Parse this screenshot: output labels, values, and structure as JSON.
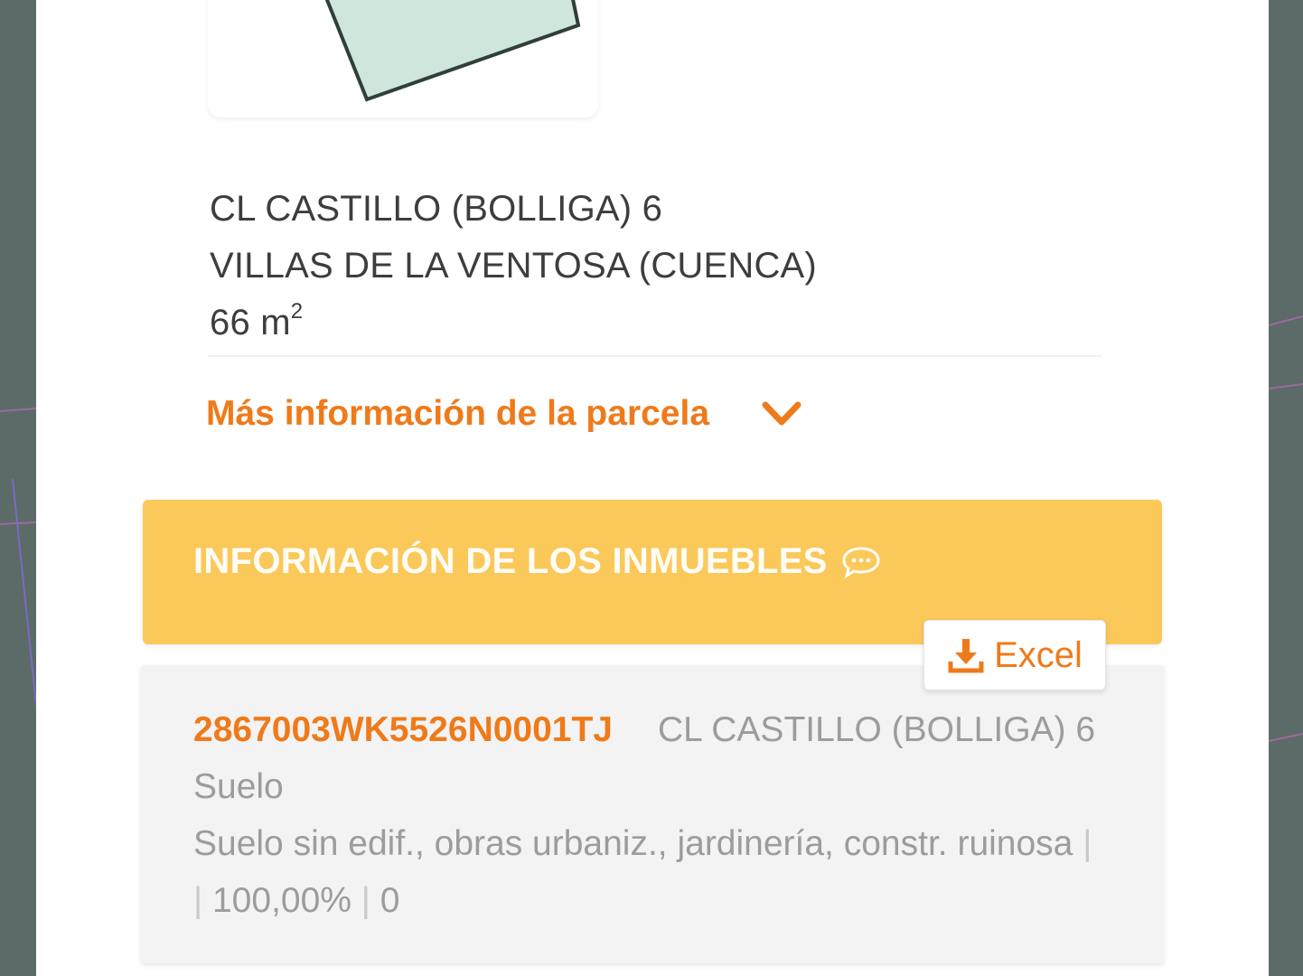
{
  "parcel": {
    "address_line1": "CL CASTILLO (BOLLIGA) 6",
    "address_line2": "VILLAS DE LA VENTOSA (CUENCA)",
    "area_value": "66 m",
    "area_exp": "2",
    "more_info_label": "Más información de la parcela"
  },
  "inmuebles": {
    "title": "INFORMACIÓN DE LOS INMUEBLES",
    "excel_label": "Excel",
    "items": [
      {
        "reference": "2867003WK5526N0001TJ",
        "address": "CL CASTILLO (BOLLIGA) 6",
        "use": "Suelo",
        "description": "Suelo sin edif., obras urbaniz., jardinería, constr. ruinosa",
        "share": "100,00%",
        "value": "0"
      }
    ]
  },
  "colors": {
    "accent": "#ef7a1a",
    "header_bg": "#fbc85a",
    "parcel_fill": "#cfe6dc"
  },
  "icons": [
    "chevron-down-icon",
    "chat-icon",
    "download-icon"
  ]
}
